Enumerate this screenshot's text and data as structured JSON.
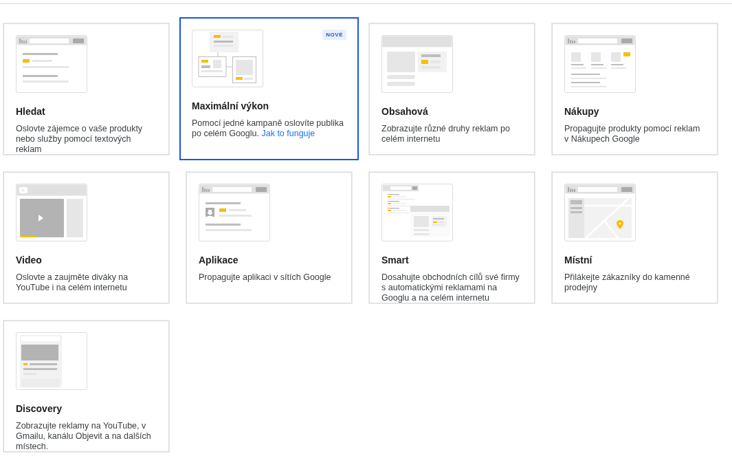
{
  "campaign_types": [
    {
      "kind": "search",
      "title": "Hledat",
      "description": "Oslovte zájemce o vaše produkty nebo služby pomocí textových reklam",
      "selected": false
    },
    {
      "kind": "performance",
      "title": "Maximální výkon",
      "description": "Pomocí jedné kampaně oslovíte publika po celém Googlu.",
      "link": "Jak to funguje",
      "badge": "NOVÉ",
      "selected": true
    },
    {
      "kind": "display",
      "title": "Obsahová",
      "description": "Zobrazujte různé druhy reklam po celém internetu",
      "selected": false
    },
    {
      "kind": "shopping",
      "title": "Nákupy",
      "description": "Propagujte produkty pomocí reklam v Nákupech Google",
      "selected": false
    },
    {
      "kind": "video",
      "title": "Video",
      "description": "Oslovte a zaujměte diváky na YouTube i na celém internetu",
      "selected": false
    },
    {
      "kind": "app",
      "title": "Aplikace",
      "description": "Propagujte aplikaci v sítích Google",
      "selected": false
    },
    {
      "kind": "smart",
      "title": "Smart",
      "description": "Dosahujte obchodních cílů své firmy s automatickými reklamami na Googlu a na celém internetu",
      "selected": false
    },
    {
      "kind": "local",
      "title": "Místní",
      "description": "Přilákejte zákazníky do kamenné prodejny",
      "selected": false
    },
    {
      "kind": "discovery",
      "title": "Discovery",
      "description": "Zobrazujte reklamy na YouTube, v Gmailu, kanálu Objevit a na dalších místech.",
      "selected": false
    }
  ]
}
